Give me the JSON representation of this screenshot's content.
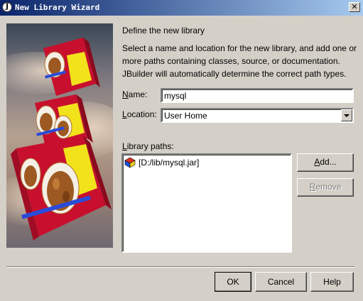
{
  "window": {
    "title": "New Library Wizard",
    "app_icon_glyph": "J"
  },
  "content": {
    "heading": "Define the new library",
    "description": "Select a name and location for the new library, and add one or more paths containing classes, source, or documentation. JBuilder will automatically determine the correct path types."
  },
  "form": {
    "name_label_mnemonic": "N",
    "name_label_rest": "ame:",
    "name_value": "mysql",
    "location_label_mnemonic": "L",
    "location_label_rest": "ocation:",
    "location_value": "User Home",
    "paths_label_mnemonic": "L",
    "paths_label_rest": "ibrary paths:",
    "paths": [
      "[D:/lib/mysql.jar]"
    ]
  },
  "buttons": {
    "add_mnemonic": "A",
    "add_rest": "dd...",
    "remove_mnemonic": "R",
    "remove_rest": "emove",
    "ok": "OK",
    "cancel": "Cancel",
    "help": "Help"
  },
  "icons": {
    "app": "jbuilder-app-icon",
    "close": "close-icon",
    "path_item": "library-archive-icon",
    "dropdown": "chevron-down-icon"
  }
}
